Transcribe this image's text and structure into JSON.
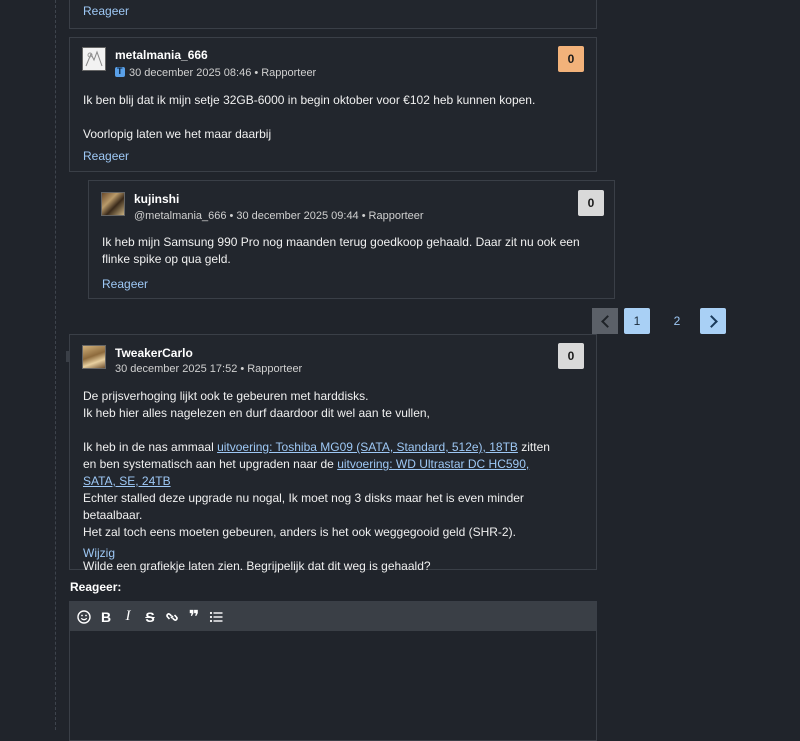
{
  "top_card": {
    "reply_label": "Reageer"
  },
  "comments": [
    {
      "username": "metalmania_666",
      "mention": "",
      "date": "30 december 2025 08:46",
      "bullet": "•",
      "report_label": "Rapporteer",
      "score": "0",
      "paragraphs": [
        "Ik ben blij dat ik mijn setje 32GB-6000 in begin oktober voor €102 heb kunnen kopen.",
        "Voorlopig laten we het maar daarbij"
      ],
      "action_label": "Reageer"
    },
    {
      "username": "kujinshi",
      "mention": "@metalmania_666",
      "date": "30 december 2025 09:44",
      "bullet": "•",
      "report_label": "Rapporteer",
      "score": "0",
      "paragraphs": [
        "Ik heb mijn Samsung 990 Pro nog maanden terug goedkoop gehaald. Daar zit nu ook een flinke spike op qua geld."
      ],
      "action_label": "Reageer"
    },
    {
      "username": "TweakerCarlo",
      "mention": "",
      "date": "30 december 2025 17:52",
      "bullet": "•",
      "report_label": "Rapporteer",
      "score": "0",
      "line1": "De prijsverhoging lijkt ook te gebeuren met harddisks.",
      "line2": "Ik heb hier alles nagelezen en durf daardoor dit wel aan te vullen,",
      "p2_pre": "Ik heb in de nas ammaal ",
      "link1": "uitvoering: Toshiba MG09 (SATA, Standard, 512e), 18TB",
      "p2_mid": " zitten en ben systematisch aan het upgraden naar de ",
      "link2": "uitvoering: WD Ultrastar DC HC590, SATA, SE, 24TB",
      "line3": "Echter stalled deze upgrade nu nogal, Ik moet nog 3 disks maar het is even minder betaalbaar.",
      "line4": "Het zal toch eens moeten gebeuren, anders is het ook weggegooid geld (SHR-2).",
      "line5": "Wilde een grafiekje laten zien. Begrijpelijk dat dit weg is gehaald?",
      "action_label": "Wijzig",
      "collapse_symbol": "−"
    }
  ],
  "pagination": {
    "pages": [
      "1",
      "2"
    ],
    "current": "1"
  },
  "reply_form": {
    "label": "Reageer:",
    "toolbar": [
      "emoji-icon",
      "bold-icon",
      "italic-icon",
      "strikethrough-icon",
      "link-icon",
      "quote-icon",
      "list-icon"
    ]
  },
  "colors": {
    "accent": "#9ec8f5",
    "score_highlight": "#f2b27a",
    "background": "#20242b"
  }
}
